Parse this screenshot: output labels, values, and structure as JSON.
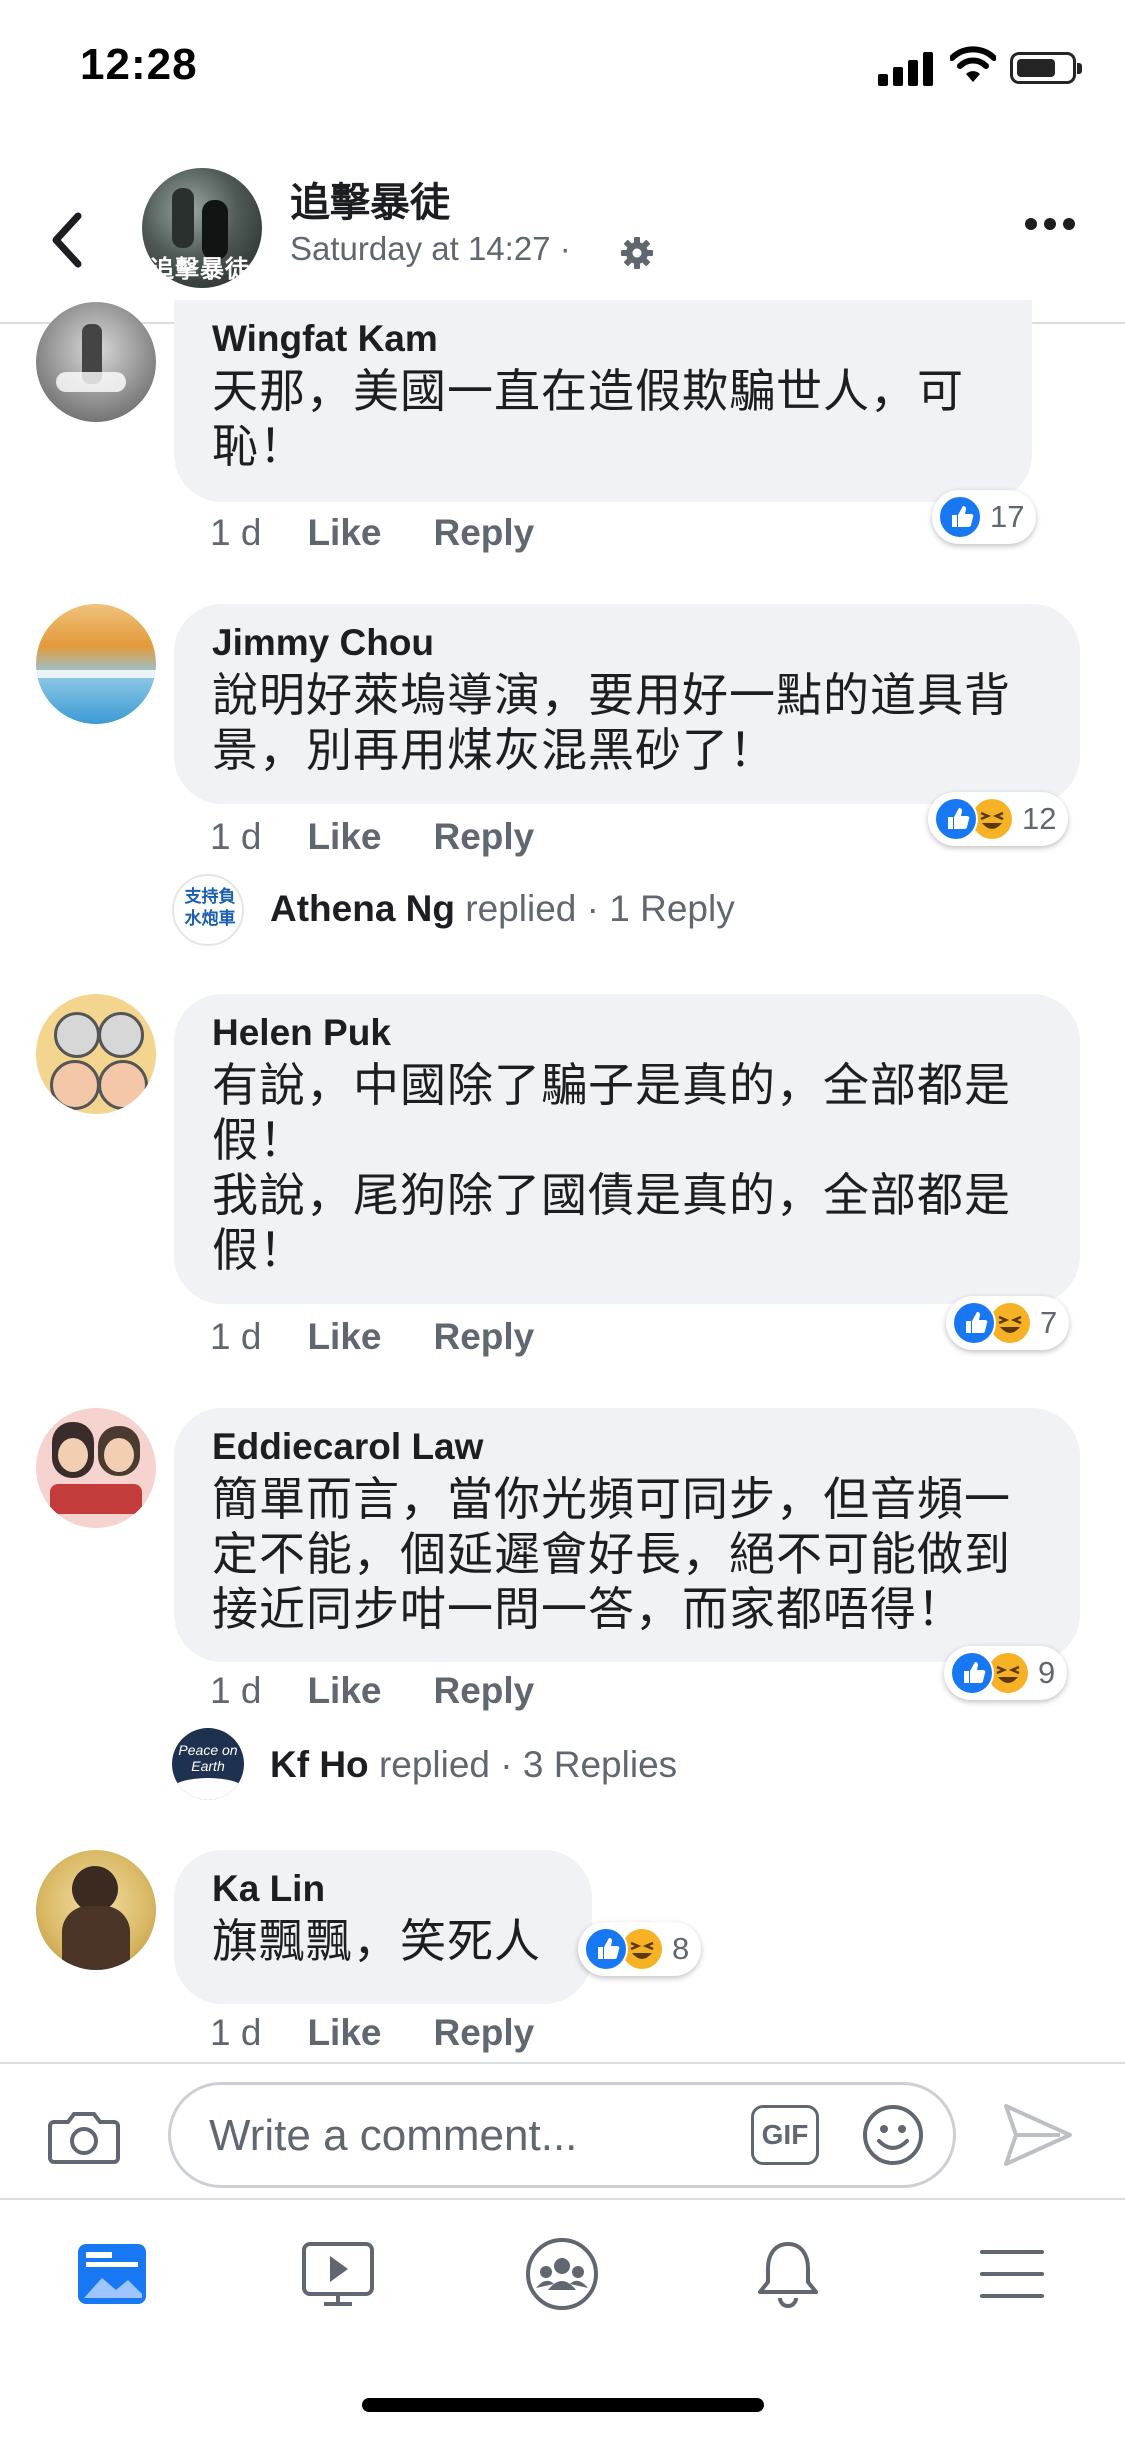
{
  "status_bar": {
    "time": "12:28"
  },
  "header": {
    "page_name": "追擊暴徒",
    "timestamp": "Saturday at 14:27 ·",
    "avatar_text": "追擊暴徒"
  },
  "comments": [
    {
      "name": "Wingfat Kam",
      "text": "天那，美國一直在造假欺騙世人，可\n恥！",
      "time": "1 d",
      "like": "Like",
      "reply": "Reply",
      "reaction_count": "17"
    },
    {
      "name": "Jimmy Chou",
      "text": "說明好萊塢導演，要用好一點的道具背\n景，別再用煤灰混黑砂了！",
      "time": "1 d",
      "like": "Like",
      "reply": "Reply",
      "reaction_count": "12",
      "reply_preview": {
        "name": "Athena Ng",
        "verb": "replied",
        "count": "· 1 Reply",
        "avatar_text": "支持負\n水炮車"
      }
    },
    {
      "name": "Helen Puk",
      "text": "有說，中國除了騙子是真的，全部都是\n假！\n我說，尾狗除了國債是真的，全部都是\n假！",
      "time": "1 d",
      "like": "Like",
      "reply": "Reply",
      "reaction_count": "7"
    },
    {
      "name": "Eddiecarol Law",
      "text": "簡單而言，當你光頻可同步，但音頻一\n定不能，個延遲會好長，絕不可能做到\n接近同步咁一問一答，而家都唔得！",
      "time": "1 d",
      "like": "Like",
      "reply": "Reply",
      "reaction_count": "9",
      "reply_preview": {
        "name": "Kf Ho",
        "verb": "replied",
        "count": "· 3 Replies",
        "avatar_text": "Peace on Earth"
      }
    },
    {
      "name": "Ka Lin",
      "text": "旗飄飄，笑死人",
      "time": "1 d",
      "like": "Like",
      "reply": "Reply",
      "reaction_count": "8"
    }
  ],
  "composer": {
    "placeholder": "Write a comment...",
    "gif_label": "GIF"
  },
  "tabbar": {
    "items": [
      "news-feed",
      "watch",
      "groups",
      "notifications",
      "menu"
    ]
  },
  "colors": {
    "accent": "#1877f2",
    "bubble": "#f0f2f5",
    "secondary_text": "#606770",
    "haha": "#f7b125"
  }
}
